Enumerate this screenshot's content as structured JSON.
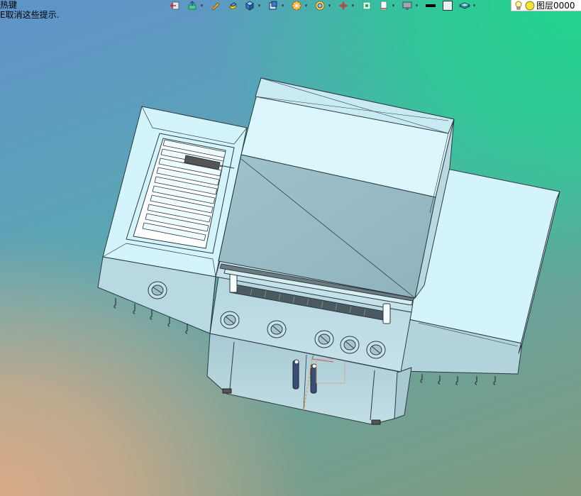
{
  "window": {
    "hint_line1": "热键",
    "hint_line2": "E取消这些提示."
  },
  "toolbar": {
    "layer_name": "图层0000",
    "icons": [
      "exit-sketch-icon",
      "view-orient-icon",
      "sketch-pencil-icon",
      "extrude-icon",
      "box-solid-icon",
      "section-view-icon",
      "appearance-icon",
      "render-icon",
      "coordinate-axis-icon",
      "fit-view-icon",
      "line-style-icon",
      "monitor-icon",
      "line-weight-icon",
      "color-swatch-icon",
      "layer-icon",
      "lightbulb-icon",
      "layer-color-icon"
    ]
  },
  "colors": {
    "model_face": "#d4f4fb",
    "model_face_dark": "#93b8c2",
    "model_edge": "#2c3a40",
    "background_top_right": "#22d58c",
    "background_bottom_left": "#d8ab88",
    "background_top_left": "#5f93c9"
  }
}
